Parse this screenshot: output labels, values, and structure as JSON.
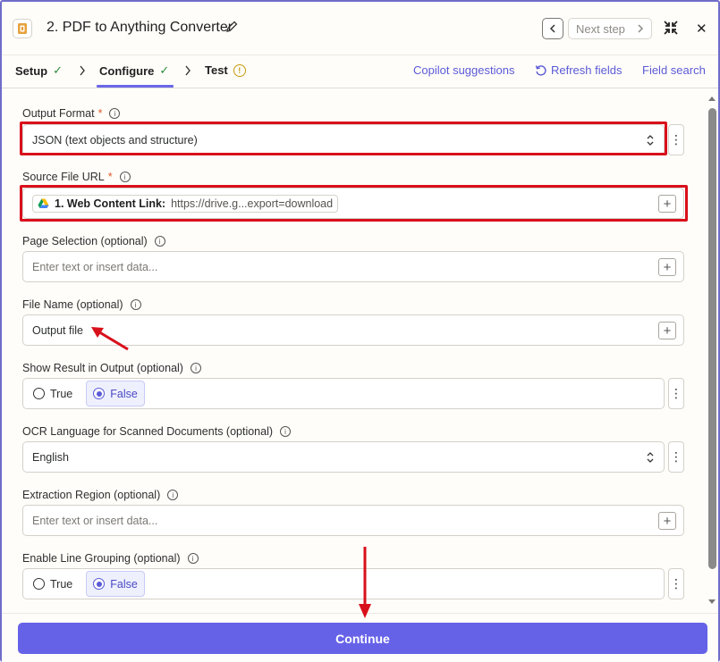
{
  "header": {
    "title": "2. PDF to Anything Converter",
    "next_step_label": "Next step"
  },
  "tabs": [
    {
      "label": "Setup"
    },
    {
      "label": "Configure"
    },
    {
      "label": "Test"
    }
  ],
  "links": {
    "copilot": "Copilot suggestions",
    "refresh": "Refresh fields",
    "field_search": "Field search"
  },
  "fields": {
    "output_format": {
      "label": "Output Format",
      "value": "JSON (text objects and structure)"
    },
    "source_file_url": {
      "label": "Source File URL",
      "pill_label": "1. Web Content Link:",
      "pill_value": "https://drive.g...export=download"
    },
    "page_selection": {
      "label": "Page Selection (optional)",
      "placeholder": "Enter text or insert data..."
    },
    "file_name": {
      "label": "File Name (optional)",
      "value": "Output file"
    },
    "show_result": {
      "label": "Show Result in Output (optional)",
      "opt_true": "True",
      "opt_false": "False",
      "selected": "False"
    },
    "ocr_language": {
      "label": "OCR Language for Scanned Documents (optional)",
      "value": "English"
    },
    "extraction_region": {
      "label": "Extraction Region (optional)",
      "placeholder": "Enter text or insert data..."
    },
    "line_grouping": {
      "label": "Enable Line Grouping (optional)",
      "opt_true": "True",
      "opt_false": "False",
      "selected": "False"
    }
  },
  "required_marker": "*",
  "continue_label": "Continue",
  "colors": {
    "accent": "#6662e8",
    "annotation": "#d8101b",
    "success": "#2e8b3e",
    "warning": "#c79a0f"
  }
}
